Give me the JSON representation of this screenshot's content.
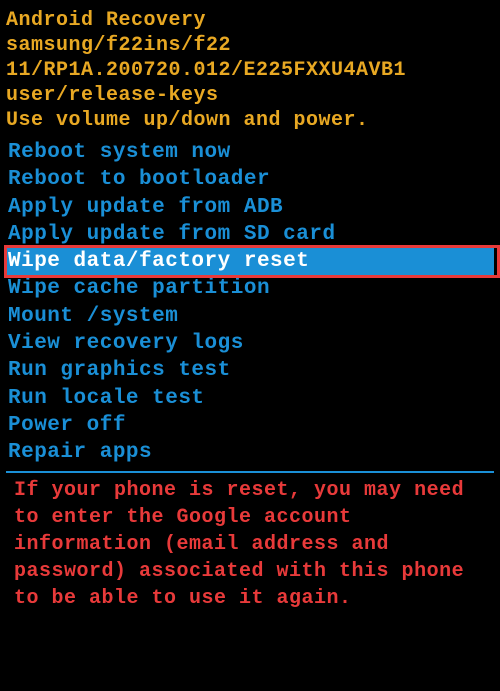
{
  "header": {
    "title": "Android Recovery",
    "device": "samsung/f22ins/f22",
    "build": "11/RP1A.200720.012/E225FXXU4AVB1",
    "keys": "user/release-keys",
    "instructions": "Use volume up/down and power."
  },
  "menu": {
    "items": [
      {
        "label": "Reboot system now",
        "selected": false
      },
      {
        "label": "Reboot to bootloader",
        "selected": false
      },
      {
        "label": "Apply update from ADB",
        "selected": false
      },
      {
        "label": "Apply update from SD card",
        "selected": false
      },
      {
        "label": "Wipe data/factory reset",
        "selected": true
      },
      {
        "label": "Wipe cache partition",
        "selected": false
      },
      {
        "label": "Mount /system",
        "selected": false
      },
      {
        "label": "View recovery logs",
        "selected": false
      },
      {
        "label": "Run graphics test",
        "selected": false
      },
      {
        "label": "Run locale test",
        "selected": false
      },
      {
        "label": "Power off",
        "selected": false
      },
      {
        "label": "Repair apps",
        "selected": false
      }
    ]
  },
  "warning": {
    "text": "If your phone is reset, you may need to enter the Google account information (email address and password) associated with this phone to be able to use it again."
  }
}
